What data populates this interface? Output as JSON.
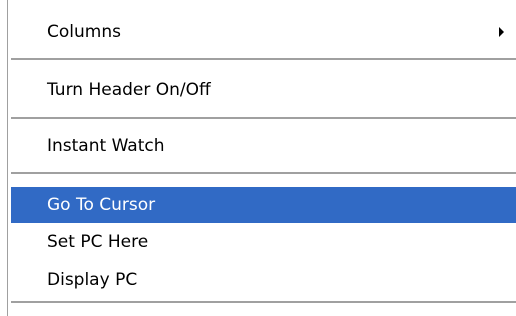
{
  "menu": {
    "items": [
      {
        "label": "Columns",
        "mnemonic": "l",
        "has_submenu": true,
        "selected": false
      },
      {
        "label": "Turn Header On/Off",
        "mnemonic": "H",
        "has_submenu": false,
        "selected": false
      },
      {
        "label": "Instant Watch",
        "mnemonic": "",
        "has_submenu": false,
        "selected": false
      },
      {
        "label": "Go To Cursor",
        "mnemonic": "u",
        "has_submenu": false,
        "selected": true
      },
      {
        "label": "Set PC Here",
        "mnemonic": "e",
        "has_submenu": false,
        "selected": false
      },
      {
        "label": "Display PC",
        "mnemonic": "y",
        "has_submenu": false,
        "selected": false
      }
    ]
  },
  "icons": {
    "submenu_arrow": "triangle-right-icon"
  },
  "colors": {
    "selection_background": "#316ac5",
    "selection_text": "#ffffff",
    "separator": "#a0a0a0",
    "text": "#000000"
  }
}
